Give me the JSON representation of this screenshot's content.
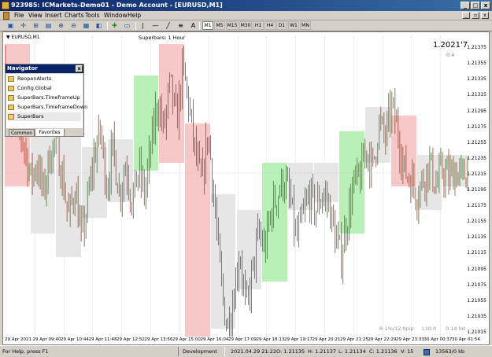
{
  "window": {
    "title": "923985: ICMarkets-Demo01 - Demo Account - [EURUSD,M1]",
    "controls": [
      "_",
      "□",
      "x"
    ]
  },
  "menu": [
    "File",
    "View",
    "Insert",
    "Charts",
    "Tools",
    "Window",
    "Help"
  ],
  "timeframes": [
    "M1",
    "M5",
    "M15",
    "M30",
    "H1",
    "H4",
    "D1",
    "W1",
    "MN"
  ],
  "active_timeframe": "M1",
  "chart": {
    "symbol_label": "▼ EURUSD,M1",
    "indicator_title": "Superbars: 1 Hour",
    "bid_price": "1.2021'7",
    "spread": "0.4",
    "bottom_info": [
      "R 1%/12.0pip",
      "L10.0",
      "0.14 lot"
    ],
    "price_labels": [
      "1.21375",
      "1.21355",
      "1.21335",
      "1.21315",
      "1.21295",
      "1.21275",
      "1.21255",
      "1.21235",
      "1.21215",
      "1.21195",
      "1.21175",
      "1.21155",
      "1.21135",
      "1.21115",
      "1.21095",
      "1.21075",
      "1.21055",
      "1.21035",
      "1.21015"
    ],
    "time_labels": [
      "29 Apr 2021",
      "29 Apr 09:40",
      "29 Apr 10:44",
      "29 Apr 11:48",
      "29 Apr 12:52",
      "29 Apr 13:56",
      "29 Apr 15:00",
      "29 Apr 16:04",
      "29 Apr 17:09",
      "29 Apr 18:13",
      "29 Apr 19:17",
      "29 Apr 20:21",
      "29 Apr 21:25",
      "29 Apr 22:29",
      "29 Apr 23:33",
      "30 Apr 00:37",
      "30 Apr 01:54"
    ],
    "colors": {
      "bull": "#b8f0b8",
      "bear": "#f8c8c8",
      "neutral": "#e6e6e6",
      "up_candle": "#3a7a28",
      "down_candle": "#b83820"
    }
  },
  "chart_data": {
    "type": "candlestick",
    "title": "Superbars: 1 Hour",
    "symbol": "EURUSD,M1",
    "ylim": [
      1.2101,
      1.2139
    ],
    "x_ticks": [
      "29 Apr 2021",
      "29 Apr 09:40",
      "29 Apr 10:44",
      "29 Apr 11:48",
      "29 Apr 12:52",
      "29 Apr 13:56",
      "29 Apr 15:00",
      "29 Apr 16:04",
      "29 Apr 17:09",
      "29 Apr 18:13",
      "29 Apr 19:17",
      "29 Apr 20:21",
      "29 Apr 21:25",
      "29 Apr 22:29",
      "29 Apr 23:33",
      "30 Apr 00:37",
      "30 Apr 01:54"
    ],
    "hourly_superbars": [
      {
        "type": "bear",
        "low": 1.212,
        "high": 1.2138
      },
      {
        "type": "neutral",
        "low": 1.2114,
        "high": 1.213
      },
      {
        "type": "neutral",
        "low": 1.2111,
        "high": 1.2128
      },
      {
        "type": "neutral",
        "low": 1.2116,
        "high": 1.2125
      },
      {
        "type": "neutral",
        "low": 1.2118,
        "high": 1.2126
      },
      {
        "type": "bull",
        "low": 1.2122,
        "high": 1.2134
      },
      {
        "type": "bear",
        "low": 1.2123,
        "high": 1.2138
      },
      {
        "type": "bear",
        "low": 1.2101,
        "high": 1.2128
      },
      {
        "type": "neutral",
        "low": 1.2102,
        "high": 1.2119
      },
      {
        "type": "neutral",
        "low": 1.2107,
        "high": 1.2117
      },
      {
        "type": "bull",
        "low": 1.2108,
        "high": 1.2123
      },
      {
        "type": "neutral",
        "low": 1.2117,
        "high": 1.2123
      },
      {
        "type": "neutral",
        "low": 1.2118,
        "high": 1.2123
      },
      {
        "type": "bull",
        "low": 1.2114,
        "high": 1.2127
      },
      {
        "type": "neutral",
        "low": 1.2123,
        "high": 1.213
      },
      {
        "type": "bear",
        "low": 1.212,
        "high": 1.2129
      },
      {
        "type": "neutral",
        "low": 1.2117,
        "high": 1.2124
      },
      {
        "type": "neutral",
        "low": 1.212,
        "high": 1.2124
      }
    ],
    "path": [
      1.2136,
      1.2132,
      1.2128,
      1.2125,
      1.2121,
      1.2123,
      1.2119,
      1.2124,
      1.2126,
      1.2121,
      1.2116,
      1.212,
      1.2113,
      1.2118,
      1.2124,
      1.2127,
      1.212,
      1.2125,
      1.2119,
      1.2123,
      1.2118,
      1.2122,
      1.2119,
      1.2125,
      1.2131,
      1.2127,
      1.2133,
      1.2128,
      1.2135,
      1.213,
      1.2124,
      1.212,
      1.2127,
      1.2118,
      1.2108,
      1.2102,
      1.2106,
      1.2112,
      1.2104,
      1.2109,
      1.2114,
      1.2112,
      1.2117,
      1.2119,
      1.2121,
      1.2118,
      1.2113,
      1.2116,
      1.2119,
      1.2117,
      1.2119,
      1.2118,
      1.2114,
      1.2111,
      1.2116,
      1.212,
      1.2121,
      1.2125,
      1.2122,
      1.2128,
      1.2126,
      1.213,
      1.2127,
      1.2122,
      1.2121,
      1.2119,
      1.2121,
      1.2123,
      1.212,
      1.2122,
      1.2121,
      1.2122,
      1.2121,
      1.2122
    ]
  },
  "navigator": {
    "title": "Navigator",
    "items": [
      "ReopenAlerts",
      "Config.Global",
      "SuperBars.TimeframeUp",
      "SuperBars.TimeframeDown",
      "SuperBars"
    ],
    "tabs": [
      "Common",
      "Favorites"
    ],
    "active_tab": "Favorites"
  },
  "status": {
    "help": "For Help, press F1",
    "profile": "Development",
    "datetime": "2021.04.29 21:22",
    "open": "O: 1.21135",
    "high": "H: 1.21137",
    "low": "L: 1.21134",
    "close": "C: 1.21136",
    "volume": "V: 15",
    "traffic": "13563/0 kb"
  }
}
